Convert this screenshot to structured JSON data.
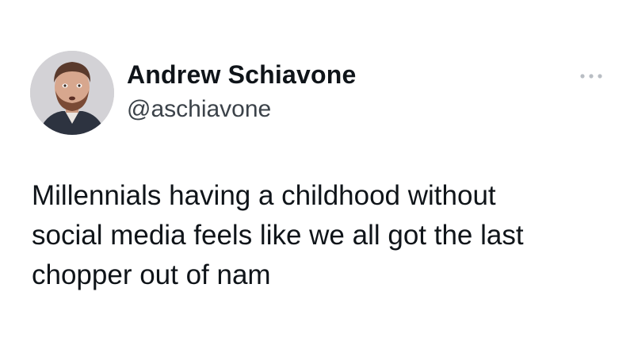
{
  "tweet": {
    "author": {
      "name": "Andrew Schiavone",
      "handle": "@aschiavone",
      "avatar_icon": "profile-photo"
    },
    "more_icon": "more-horizontal-icon",
    "text_lines": [
      "Millennials having a childhood without",
      "social media feels like we all got the last",
      "chopper out of nam"
    ]
  }
}
